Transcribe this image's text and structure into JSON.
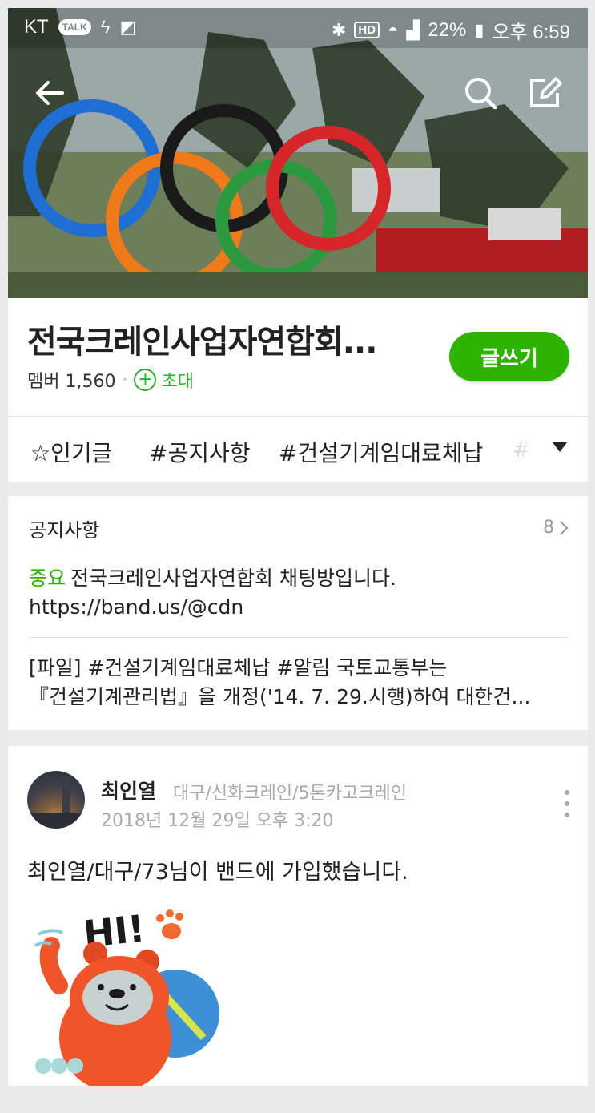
{
  "status_bar": {
    "carrier": "KT",
    "talk_badge": "TALK",
    "battery": "22%",
    "time": "오후 6:59"
  },
  "band": {
    "title": "전국크레인사업자연합회...",
    "members": "멤버 1,560",
    "invite_label": "초대",
    "write_label": "글쓰기"
  },
  "tags": [
    "☆인기글",
    "#공지사항",
    "#건설기계임대료체납",
    "#"
  ],
  "notice": {
    "heading": "공지사항",
    "count": "8",
    "item1_badge": "중요",
    "item1_text": "전국크레인사업자연합회 채팅방입니다.",
    "item1_link": "https://band.us/@cdn",
    "item2_line1": "[파일] #건설기계임대료체납 #알림  국토교통부는",
    "item2_line2": "『건설기계관리법』을 개정('14. 7. 29.시행)하여 대한건..."
  },
  "post": {
    "author": "최인열",
    "author_sub": "대구/신화크레인/5톤카고크레인",
    "date": "2018년 12월 29일 오후 3:20",
    "body": "최인열/대구/73님이 밴드에 가입했습니다.",
    "sticker_text": "HI!"
  },
  "colors": {
    "brand_green": "#2db400",
    "text_dark": "#222222",
    "text_muted": "#aaaaaa"
  },
  "icons": [
    "back-arrow-icon",
    "search-icon",
    "edit-icon",
    "plus-circle-icon",
    "dropdown-triangle-icon",
    "chevron-right-icon",
    "more-vertical-icon"
  ]
}
